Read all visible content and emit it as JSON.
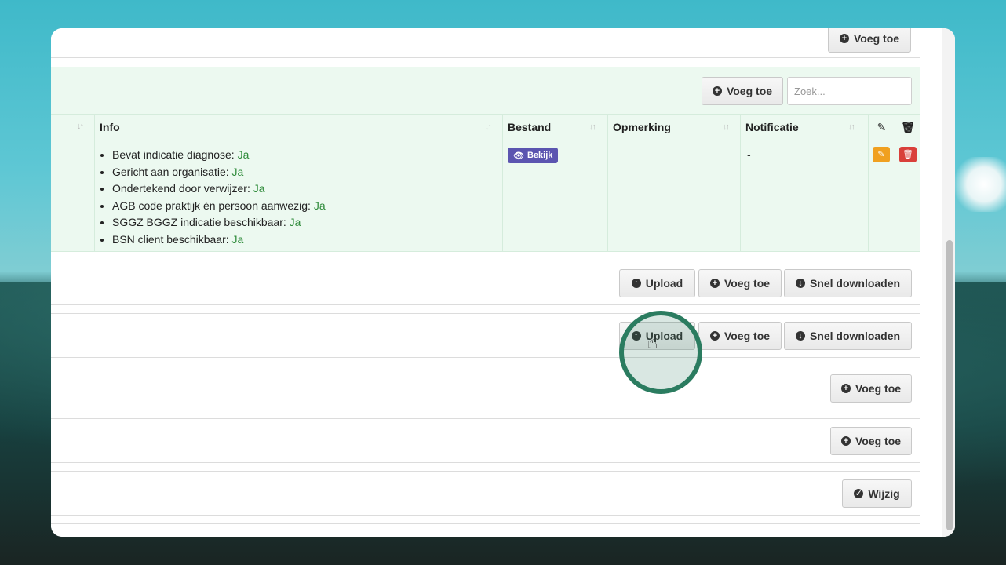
{
  "panel1": {
    "add_label": "Voeg toe"
  },
  "panel2": {
    "add_label": "Voeg toe",
    "search_placeholder": "Zoek...",
    "columns": [
      "Info",
      "Bestand",
      "Opmerking",
      "Notificatie"
    ],
    "info_items": [
      {
        "label": "Bevat indicatie diagnose: ",
        "value": "Ja"
      },
      {
        "label": "Gericht aan organisatie: ",
        "value": "Ja"
      },
      {
        "label": "Ondertekend door verwijzer: ",
        "value": "Ja"
      },
      {
        "label": "AGB code praktijk én persoon aanwezig: ",
        "value": "Ja"
      },
      {
        "label": "SGGZ BGGZ indicatie beschikbaar: ",
        "value": "Ja"
      },
      {
        "label": "BSN client beschikbaar: ",
        "value": "Ja"
      }
    ],
    "bestand_badge": "Bekijk",
    "notificatie_value": "-"
  },
  "panel3": {
    "upload_label": "Upload",
    "add_label": "Voeg toe",
    "download_label": "Snel downloaden"
  },
  "panel4": {
    "upload_label": "Upload",
    "add_label": "Voeg toe",
    "download_label": "Snel downloaden"
  },
  "panel5": {
    "add_label": "Voeg toe"
  },
  "panel6": {
    "add_label": "Voeg toe"
  },
  "panel7": {
    "edit_label": "Wijzig"
  },
  "colors": {
    "accent_green_bg": "#ecf9f0",
    "badge_purple": "#5b55b0",
    "edit_orange": "#f0a020",
    "delete_red": "#d9403a",
    "cursor_ring": "#2b7c60",
    "value_green": "#2e8b3a"
  }
}
